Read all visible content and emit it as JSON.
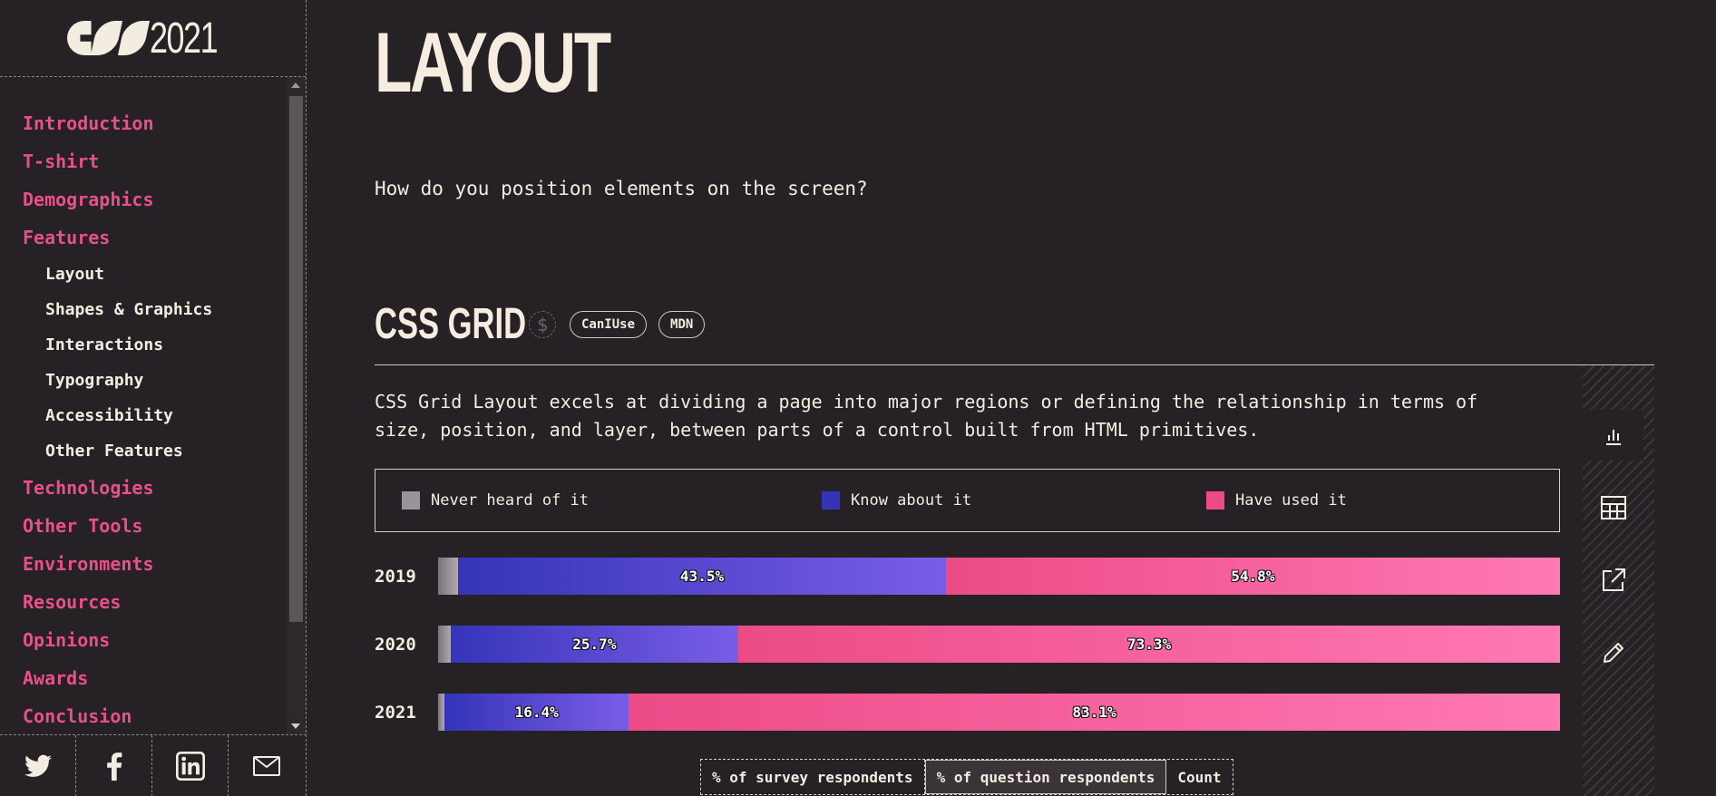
{
  "brand": {
    "year": "2021"
  },
  "nav": {
    "items": [
      {
        "label": "Introduction",
        "level": "top"
      },
      {
        "label": "T-shirt",
        "level": "top"
      },
      {
        "label": "Demographics",
        "level": "top"
      },
      {
        "label": "Features",
        "level": "top"
      },
      {
        "label": "Layout",
        "level": "sub"
      },
      {
        "label": "Shapes & Graphics",
        "level": "sub"
      },
      {
        "label": "Interactions",
        "level": "sub"
      },
      {
        "label": "Typography",
        "level": "sub"
      },
      {
        "label": "Accessibility",
        "level": "sub"
      },
      {
        "label": "Other Features",
        "level": "sub"
      },
      {
        "label": "Technologies",
        "level": "top"
      },
      {
        "label": "Other Tools",
        "level": "top"
      },
      {
        "label": "Environments",
        "level": "top"
      },
      {
        "label": "Resources",
        "level": "top"
      },
      {
        "label": "Opinions",
        "level": "top"
      },
      {
        "label": "Awards",
        "level": "top"
      },
      {
        "label": "Conclusion",
        "level": "top"
      }
    ]
  },
  "social": [
    "twitter-icon",
    "facebook-icon",
    "linkedin-icon",
    "email-icon"
  ],
  "page": {
    "title": "LAYOUT",
    "intro": "How do you position elements on the screen?"
  },
  "block": {
    "title": "CSS GRID",
    "sponsor_symbol": "$",
    "links": [
      "CanIUse",
      "MDN"
    ],
    "description": "CSS Grid Layout excels at dividing a page into major regions or defining the relationship in terms of size, position, and layer, between parts of a control built from HTML primitives."
  },
  "colors": {
    "never": "#9a949a",
    "know": "#3534b9",
    "used": "#ec4b86"
  },
  "chart_data": {
    "type": "bar",
    "orientation": "horizontal-stacked",
    "categories": [
      "2019",
      "2020",
      "2021"
    ],
    "series": [
      {
        "name": "Never heard of it",
        "values": [
          1.8,
          1.1,
          0.6
        ]
      },
      {
        "name": "Know about it",
        "values": [
          43.5,
          25.7,
          16.4
        ]
      },
      {
        "name": "Have used it",
        "values": [
          54.8,
          73.3,
          83.1
        ]
      }
    ],
    "data_labels": {
      "Know about it": [
        "43.5%",
        "25.7%",
        "16.4%"
      ],
      "Have used it": [
        "54.8%",
        "73.3%",
        "83.1%"
      ]
    },
    "legend": "top"
  },
  "units": {
    "options": [
      "% of survey respondents",
      "% of question respondents",
      "Count"
    ],
    "selected": "% of question respondents"
  },
  "toolbar": [
    "bar-chart-icon",
    "table-icon",
    "share-icon",
    "edit-icon"
  ]
}
